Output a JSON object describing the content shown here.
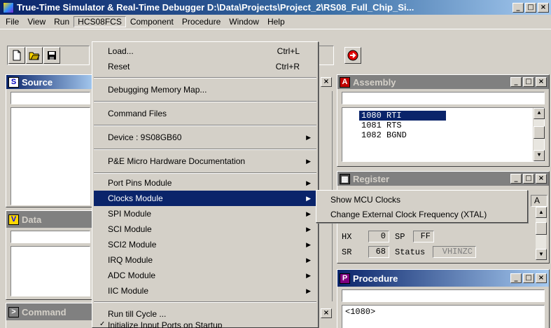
{
  "window": {
    "title": "True-Time Simulator & Real-Time Debugger  D:\\Data\\Projects\\Project_2\\RS08_Full_Chip_Si...",
    "controls": [
      "_",
      "□",
      "×"
    ]
  },
  "menubar": {
    "items": [
      "File",
      "View",
      "Run",
      "HCS08FCS",
      "Component",
      "Procedure",
      "Window",
      "Help"
    ]
  },
  "hcs08_menu": {
    "load": "Load...",
    "load_accel": "Ctrl+L",
    "reset": "Reset",
    "reset_accel": "Ctrl+R",
    "debug_map": "Debugging Memory Map...",
    "command_files": "Command Files",
    "device": "Device : 9S08GB60",
    "pe_docs": "P&E Micro Hardware Documentation",
    "port_pins": "Port Pins Module",
    "clocks": "Clocks Module",
    "spi": "SPI Module",
    "sci": "SCI Module",
    "sci2": "SCI2 Module",
    "irq": "IRQ Module",
    "adc": "ADC Module",
    "iic": "IIC Module",
    "run_till": "Run till Cycle ...",
    "init_ports": "Initialize Input Ports on Startup"
  },
  "clocks_submenu": {
    "show": "Show MCU Clocks",
    "change": "Change External Clock Frequency (XTAL)"
  },
  "panels": {
    "source": "Source",
    "data": "Data",
    "command": "Command",
    "assembly": "Assembly",
    "register": "Register",
    "procedure": "Procedure"
  },
  "assembly": {
    "lines": [
      "1080 RTI",
      "1081 RTS",
      "1082 BGND"
    ]
  },
  "register": {
    "hx_label": "HX",
    "hx_value": "0",
    "sp_label": "SP",
    "sp_value": "FF",
    "sr_label": "SR",
    "sr_value": "68",
    "status_label": "Status",
    "status_value": "VHINZC",
    "a_label": "A"
  },
  "procedure": {
    "line": "<1080>"
  }
}
